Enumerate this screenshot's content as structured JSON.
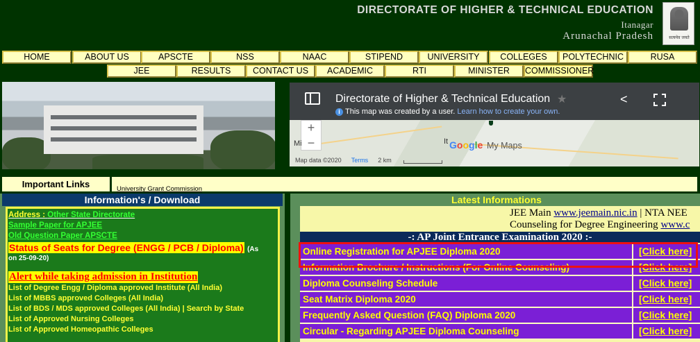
{
  "header": {
    "title": "DIRECTORATE OF HIGHER & TECHNICAL EDUCATION",
    "city": "Itanagar",
    "state": "Arunachal Pradesh",
    "emblem_caption": "सत्यमेव जयते"
  },
  "nav": {
    "row1": [
      "HOME",
      "ABOUT US",
      "APSCTE",
      "NSS",
      "NAAC",
      "STIPEND",
      "UNIVERSITY",
      "COLLEGES",
      "POLYTECHNIC",
      "RUSA"
    ],
    "row2": [
      "JEE",
      "RESULTS",
      "CONTACT US",
      "ACADEMIC",
      "RTI",
      "MINISTER",
      "COMMISSIONER"
    ]
  },
  "map": {
    "title": "Directorate of Higher & Technical Education",
    "notice": "This map was created by a user.",
    "learn_link": "Learn how to create your own.",
    "brand_word": "Google",
    "product": "My Maps",
    "town_label": "It",
    "left_label": "Mi",
    "footer_data": "Map data ©2020",
    "footer_terms": "Terms",
    "scale_label": "2 km",
    "zoom_in": "+",
    "zoom_out": "−"
  },
  "important_links": {
    "label": "Important Links",
    "ticker": "University Grant Commission"
  },
  "info": {
    "heading": "Information's / Download",
    "address_prefix": "Address :",
    "address_link": "Other State Directorate",
    "sample_paper": "Sample Paper for APJEE",
    "old_paper": "Old Question Paper APSCTE",
    "status_text": "Status of Seats for Degree (ENGG / PCB / Diploma)",
    "status_date_a": "(As",
    "status_date_b": "on 25-09-20)",
    "alert_text": "Alert while taking admission in Institution",
    "list": [
      "List of Degree Engg / Diploma approved Institute (All India)",
      "List of MBBS approved Colleges (All India)",
      "List of BDS / MDS approved Colleges (All India) | Search by State",
      "List of Approved Nursing Colleges",
      "List of Approved Homeopathic Colleges"
    ]
  },
  "latest": {
    "heading": "Latest Informations",
    "ticker_line1_pre": "JEE Main ",
    "ticker_line1_link": "www.jeemain.nic.in",
    "ticker_line1_post": " | NTA NEE",
    "ticker_line2_pre": "Counseling for Degree Engineering ",
    "ticker_line2_link": "www.c",
    "jee_title": "-: AP Joint Entrance Examination 2020 :-",
    "rows": [
      {
        "title": "Online Registration for APJEE Diploma 2020",
        "link": "[Click here]"
      },
      {
        "title": "Information Brochure / Instructions (For Online Counseling)",
        "link": "[Click here]"
      },
      {
        "title": "Diploma Counseling Schedule",
        "link": "[Click here]"
      },
      {
        "title": "Seat Matrix Diploma 2020",
        "link": "[Click here]"
      },
      {
        "title": "Frequently Asked Question (FAQ) Diploma 2020",
        "link": "[Click here]"
      },
      {
        "title": "Circular - Regarding APJEE Diploma Counseling",
        "link": "[Click here]"
      }
    ]
  },
  "colors": {
    "page_bg": "#003300",
    "nav_bg": "#ffffc0",
    "row_bg": "#7b1fd6",
    "row_text": "#ffff00",
    "highlight": "#ee1111"
  }
}
